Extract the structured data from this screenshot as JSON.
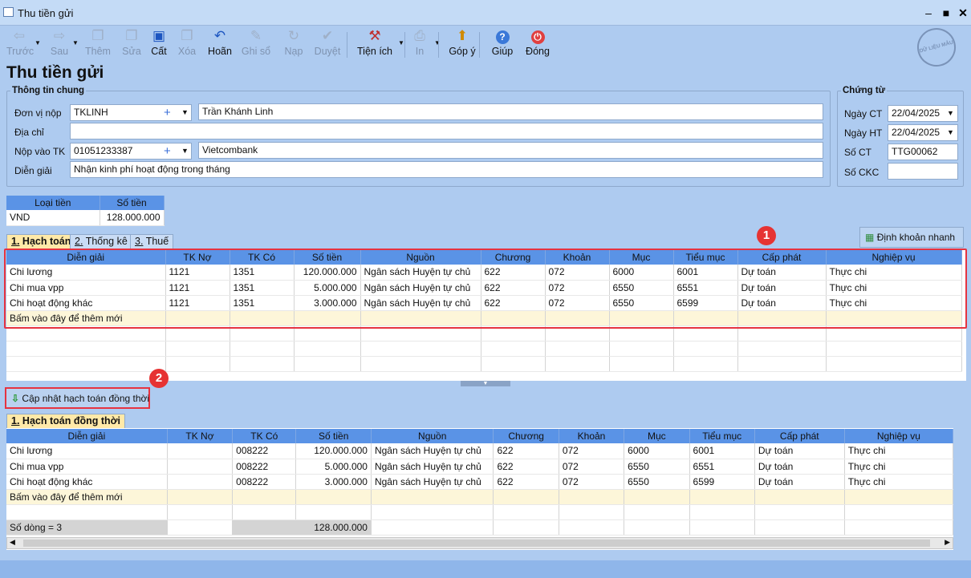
{
  "window": {
    "title": "Thu tiền gửi"
  },
  "toolbar": [
    {
      "label": "Trước",
      "icon": "arrow-left-icon",
      "enabled": false
    },
    {
      "label": "Sau",
      "icon": "arrow-right-icon",
      "enabled": false
    },
    {
      "label": "Thêm",
      "icon": "add-doc-icon",
      "enabled": false
    },
    {
      "label": "Sửa",
      "icon": "edit-doc-icon",
      "enabled": false
    },
    {
      "label": "Cất",
      "icon": "save-icon",
      "enabled": true
    },
    {
      "label": "Xóa",
      "icon": "delete-doc-icon",
      "enabled": false
    },
    {
      "label": "Hoãn",
      "icon": "undo-icon",
      "enabled": true
    },
    {
      "label": "Ghi sổ",
      "icon": "pencil-icon",
      "enabled": false
    },
    {
      "label": "Nạp",
      "icon": "reload-icon",
      "enabled": false
    },
    {
      "label": "Duyệt",
      "icon": "check-icon",
      "enabled": false
    },
    {
      "label": "Tiện ích",
      "icon": "tools-icon",
      "enabled": true
    },
    {
      "label": "In",
      "icon": "printer-icon",
      "enabled": false
    },
    {
      "label": "Góp ý",
      "icon": "feedback-icon",
      "enabled": true
    },
    {
      "label": "Giúp",
      "icon": "help-icon",
      "enabled": true
    },
    {
      "label": "Đóng",
      "icon": "power-icon",
      "enabled": true
    }
  ],
  "stamp": "DỮ LIỆU MẪU",
  "page_title": "Thu tiền gửi",
  "general": {
    "legend": "Thông tin chung",
    "payer_label": "Đơn vị nộp",
    "payer_code": "TKLINH",
    "payer_name": "Trần Khánh Linh",
    "address_label": "Địa chỉ",
    "address": "",
    "account_label": "Nộp vào TK",
    "account_no": "01051233387",
    "bank": "Vietcombank",
    "desc_label": "Diễn giải",
    "desc": "Nhận kinh phí hoạt động trong tháng"
  },
  "voucher": {
    "legend": "Chứng từ",
    "date_ct_label": "Ngày CT",
    "date_ct": "22/04/2025",
    "date_ht_label": "Ngày HT",
    "date_ht": "22/04/2025",
    "so_ct_label": "Số CT",
    "so_ct": "TTG00062",
    "so_ckc_label": "Số CKC",
    "so_ckc": ""
  },
  "currency": {
    "h1": "Loại tiền",
    "h2": "Số tiền",
    "type": "VND",
    "amount": "128.000.000"
  },
  "tabs": {
    "t1": "Hạch toán",
    "t1n": "1.",
    "t2": "Thống kê",
    "t2n": "2.",
    "t3": "Thuế",
    "t3n": "3."
  },
  "quick_button": "Định khoản nhanh",
  "columns": [
    "Diễn giải",
    "TK Nợ",
    "TK Có",
    "Số tiền",
    "Nguồn",
    "Chương",
    "Khoản",
    "Mục",
    "Tiểu mục",
    "Cấp phát",
    "Nghiệp vụ"
  ],
  "rows1": [
    [
      "Chi lương",
      "1121",
      "1351",
      "120.000.000",
      "Ngân sách Huyện tự chủ",
      "622",
      "072",
      "6000",
      "6001",
      "Dự toán",
      "Thực chi"
    ],
    [
      "Chi mua vpp",
      "1121",
      "1351",
      "5.000.000",
      "Ngân sách Huyện tự chủ",
      "622",
      "072",
      "6550",
      "6551",
      "Dự toán",
      "Thực chi"
    ],
    [
      "Chi hoạt động khác",
      "1121",
      "1351",
      "3.000.000",
      "Ngân sách Huyện tự chủ",
      "622",
      "072",
      "6550",
      "6599",
      "Dự toán",
      "Thực chi"
    ]
  ],
  "add_row": "Bấm vào đây để thêm mới",
  "update_button": "Cập nhật hạch toán đồng thời",
  "tab2": {
    "num": "1.",
    "label": "Hạch toán đồng thời"
  },
  "rows2": [
    [
      "Chi lương",
      "",
      "008222",
      "120.000.000",
      "Ngân sách Huyện tự chủ",
      "622",
      "072",
      "6000",
      "6001",
      "Dự toán",
      "Thực chi"
    ],
    [
      "Chi mua vpp",
      "",
      "008222",
      "5.000.000",
      "Ngân sách Huyện tự chủ",
      "622",
      "072",
      "6550",
      "6551",
      "Dự toán",
      "Thực chi"
    ],
    [
      "Chi hoạt động khác",
      "",
      "008222",
      "3.000.000",
      "Ngân sách Huyện tự chủ",
      "622",
      "072",
      "6550",
      "6599",
      "Dự toán",
      "Thực chi"
    ]
  ],
  "footer": {
    "count": "Số dòng = 3",
    "total": "128.000.000"
  },
  "badges": [
    "1",
    "2"
  ]
}
